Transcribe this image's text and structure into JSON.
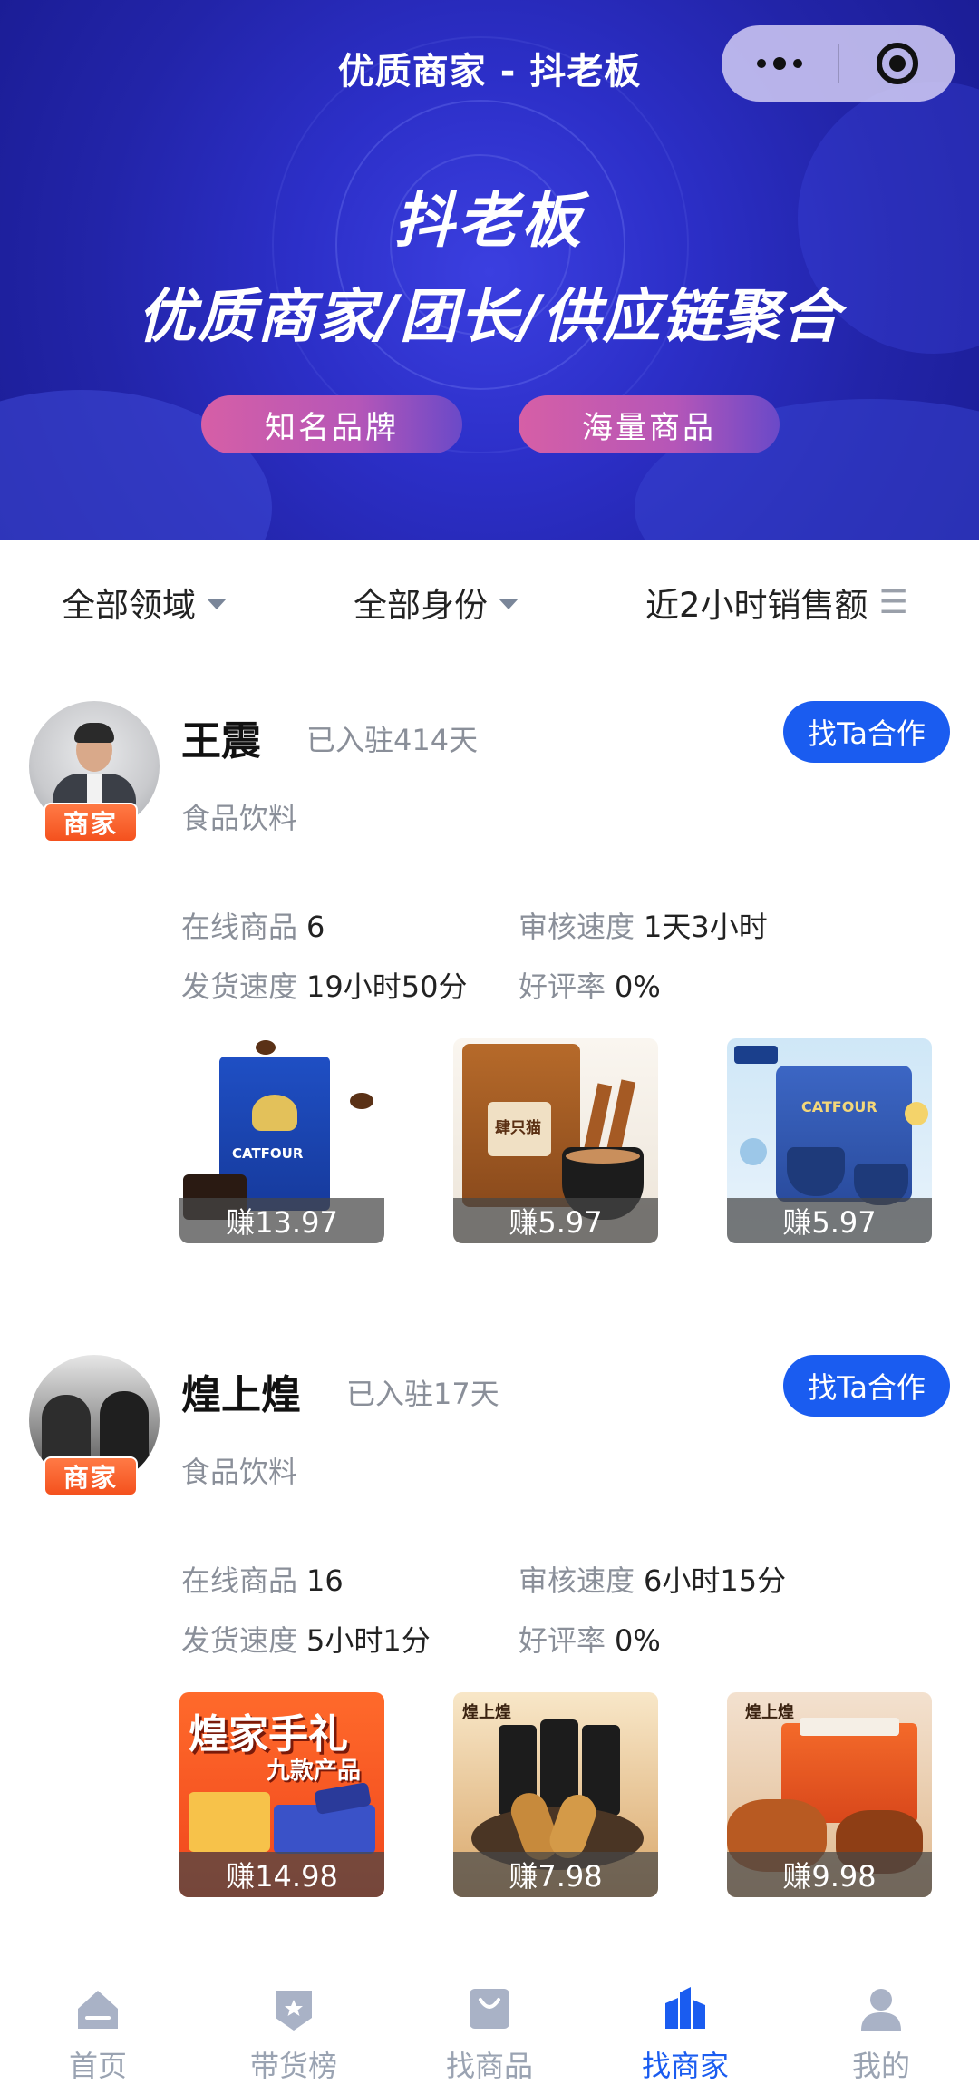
{
  "nav": {
    "title": "优质商家 - 抖老板"
  },
  "banner": {
    "title": "抖老板",
    "subtitle": "优质商家/团长/供应链聚合",
    "pills": [
      "知名品牌",
      "海量商品"
    ]
  },
  "filters": {
    "domain": "全部领域",
    "identity": "全部身份",
    "sort": "近2小时销售额"
  },
  "merchants": [
    {
      "name": "王震",
      "joined": "已入驻414天",
      "badge": "商家",
      "cta": "找Ta合作",
      "category": "食品饮料",
      "stats": {
        "online_label": "在线商品",
        "online": "6",
        "review_label": "审核速度",
        "review": "1天3小时",
        "ship_label": "发货速度",
        "ship": "19小时50分",
        "rating_label": "好评率",
        "rating": "0%"
      },
      "products": [
        {
          "earn": "赚13.97",
          "art_text": "CATFOUR"
        },
        {
          "earn": "赚5.97",
          "art_text": "肆只猫"
        },
        {
          "earn": "赚5.97",
          "art_text": "CATFOUR"
        }
      ]
    },
    {
      "name": "煌上煌",
      "joined": "已入驻17天",
      "badge": "商家",
      "cta": "找Ta合作",
      "category": "食品饮料",
      "stats": {
        "online_label": "在线商品",
        "online": "16",
        "review_label": "审核速度",
        "review": "6小时15分",
        "ship_label": "发货速度",
        "ship": "5小时1分",
        "rating_label": "好评率",
        "rating": "0%"
      },
      "products": [
        {
          "earn": "赚14.98",
          "art_text": "煌家手礼",
          "art_sub": "九款产品"
        },
        {
          "earn": "赚7.98",
          "art_text": "煌上煌"
        },
        {
          "earn": "赚9.98",
          "art_text": "煌上煌"
        }
      ]
    }
  ],
  "tabbar": {
    "items": [
      {
        "label": "首页",
        "icon": "home-icon"
      },
      {
        "label": "带货榜",
        "icon": "ranking-badge-icon"
      },
      {
        "label": "找商品",
        "icon": "shopping-bag-icon"
      },
      {
        "label": "找商家",
        "icon": "store-buildings-icon",
        "active": true
      },
      {
        "label": "我的",
        "icon": "user-profile-icon"
      }
    ]
  },
  "colors": {
    "accent": "#1a5cf0",
    "badge": "#f4511e",
    "banner": "#2c2fc8"
  }
}
